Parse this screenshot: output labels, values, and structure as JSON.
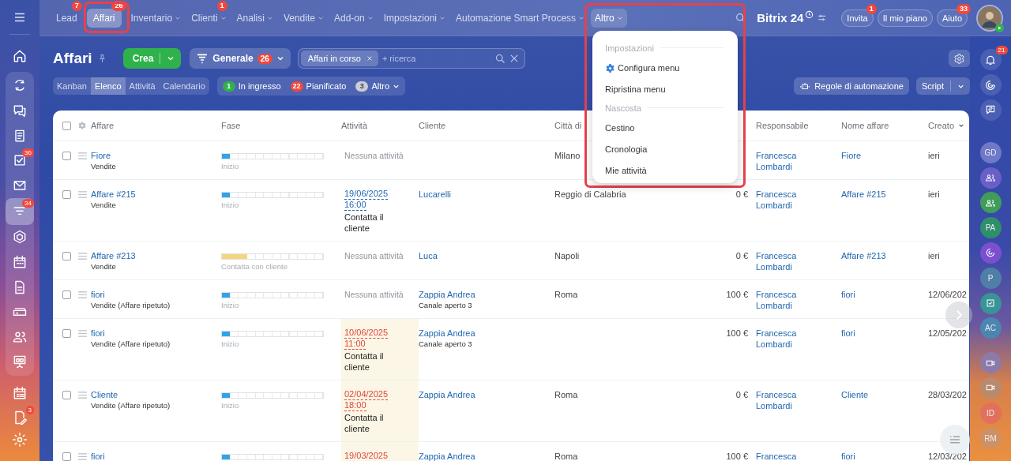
{
  "left_rail": {
    "top": [
      {
        "selected": false
      }
    ],
    "group": [
      {
        "selected": false
      },
      {
        "selected": false
      },
      {
        "selected": false
      },
      {
        "selected": false,
        "badge": "36"
      },
      {
        "selected": false
      },
      {
        "selected": true,
        "badge": "34"
      },
      {
        "selected": false
      },
      {
        "selected": false
      },
      {
        "selected": false
      },
      {
        "selected": false
      },
      {
        "selected": false
      },
      {
        "selected": false
      }
    ],
    "bottom": [
      {
        "selected": false
      },
      {
        "selected": false,
        "badge": "3"
      }
    ]
  },
  "top_nav": {
    "tabs": [
      {
        "label": "Lead",
        "badge": "7",
        "selected": false,
        "dropdown": false,
        "expanded": false,
        "highlighted": false
      },
      {
        "label": "Affari",
        "badge": "26",
        "selected": true,
        "dropdown": false,
        "expanded": false,
        "highlighted": true
      },
      {
        "label": "Inventario",
        "selected": false,
        "dropdown": true,
        "expanded": false,
        "highlighted": false
      },
      {
        "label": "Clienti",
        "badge": "1",
        "selected": false,
        "dropdown": true,
        "expanded": false,
        "highlighted": false
      },
      {
        "label": "Analisi",
        "selected": false,
        "dropdown": true,
        "expanded": false,
        "highlighted": false
      },
      {
        "label": "Vendite",
        "selected": false,
        "dropdown": true,
        "expanded": false,
        "highlighted": false
      },
      {
        "label": "Add-on",
        "selected": false,
        "dropdown": true,
        "expanded": false,
        "highlighted": false
      },
      {
        "label": "Impostazioni",
        "selected": false,
        "dropdown": true,
        "expanded": false,
        "highlighted": false
      },
      {
        "label": "Automazione Smart Process",
        "selected": false,
        "dropdown": true,
        "expanded": false,
        "highlighted": false
      },
      {
        "label": "Altro",
        "selected": false,
        "dropdown": true,
        "expanded": true,
        "highlighted": true
      }
    ],
    "logo": "Bitrix 24",
    "buttons": [
      {
        "label": "Invita",
        "badge": "1"
      },
      {
        "label": "Il mio piano"
      },
      {
        "label": "Aiuto",
        "badge": "33"
      }
    ]
  },
  "altro_menu": {
    "sections": [
      {
        "title": "Impostazioni",
        "items": [
          {
            "label": "Configura menu",
            "kind": "settings"
          },
          {
            "label": "Ripristina menu",
            "kind": "plain"
          }
        ]
      },
      {
        "title": "Nascosta",
        "items": [
          {
            "label": "Cestino",
            "kind": "plain"
          },
          {
            "label": "Cronologia",
            "kind": "plain"
          },
          {
            "label": "Mie attività",
            "kind": "plain"
          }
        ]
      }
    ]
  },
  "page": {
    "title": "Affari",
    "create_button": "Crea",
    "filter": {
      "label": "Generale",
      "badge": "26"
    },
    "search": {
      "chip": "Affari in corso",
      "placeholder": "+ ricerca"
    }
  },
  "views": [
    {
      "label": "Kanban",
      "selected": false
    },
    {
      "label": "Elenco",
      "selected": true
    },
    {
      "label": "Attività",
      "selected": false
    },
    {
      "label": "Calendario",
      "selected": false
    }
  ],
  "counters": [
    {
      "count": "1",
      "label": "In ingresso",
      "color": "#2fb24c",
      "kind": "accent",
      "dropdown": false
    },
    {
      "count": "22",
      "label": "Pianificato",
      "color": "#f0483e",
      "kind": "accent",
      "dropdown": false
    },
    {
      "count": "3",
      "label": "Altro",
      "color": "#c9ced6",
      "kind": "muted",
      "dropdown": true
    }
  ],
  "actions": {
    "automation": "Regole di automazione",
    "script": "Script"
  },
  "table": {
    "select_all_checked": false,
    "columns": [
      {
        "label": "Affare",
        "kind": "text",
        "sorted": false
      },
      {
        "label": "Fase",
        "kind": "text",
        "sorted": false
      },
      {
        "label": "Attività",
        "kind": "text",
        "sorted": false
      },
      {
        "label": "Cliente",
        "kind": "text",
        "sorted": false
      },
      {
        "label": "Città di",
        "kind": "text",
        "sorted": false
      },
      {
        "kind": "amount"
      },
      {
        "label": "Responsabile",
        "kind": "text",
        "sorted": false
      },
      {
        "label": "Nome affare",
        "kind": "text",
        "sorted": false
      },
      {
        "label": "Creato",
        "kind": "text",
        "sorted": true
      }
    ],
    "rows": [
      {
        "checked": false,
        "title": "Fiore",
        "pipeline": "Vendite",
        "phase": {
          "label": "Inizio",
          "level": 0.08,
          "color": "#2fa5e8"
        },
        "activity": {
          "kind": "none",
          "text": "Nessuna attività",
          "overdue": false
        },
        "city": "Milano",
        "owner": "Francesca Lombardi",
        "deal_name": "Fiore",
        "created": "ieri"
      },
      {
        "checked": false,
        "title": "Affare #215",
        "pipeline": "Vendite",
        "phase": {
          "label": "Inizio",
          "level": 0.08,
          "color": "#2fa5e8"
        },
        "activity": {
          "kind": "task",
          "date": "19/06/2025",
          "time": "16:00",
          "text": "Contatta il cliente",
          "overdue": false
        },
        "client": "Lucarelli",
        "city": "Reggio di Calabria",
        "amount": "0 €",
        "owner": "Francesca Lombardi",
        "deal_name": "Affare #215",
        "created": "ieri"
      },
      {
        "checked": false,
        "title": "Affare #213",
        "pipeline": "Vendite",
        "phase": {
          "label": "Contatta con cliente",
          "level": 0.25,
          "color": "#f7d57e"
        },
        "activity": {
          "kind": "none",
          "text": "Nessuna attività",
          "overdue": false
        },
        "client": "Luca",
        "city": "Napoli",
        "amount": "0 €",
        "owner": "Francesca Lombardi",
        "deal_name": "Affare #213",
        "created": "ieri"
      },
      {
        "checked": false,
        "title": "fiori",
        "pipeline": "Vendite (Affare ripetuto)",
        "phase": {
          "label": "Inizio",
          "level": 0.08,
          "color": "#2fa5e8"
        },
        "activity": {
          "kind": "none",
          "text": "Nessuna attività",
          "overdue": false
        },
        "client": "Zappia Andrea",
        "client_note": "Canale aperto 3",
        "city": "Roma",
        "amount": "100 €",
        "owner": "Francesca Lombardi",
        "deal_name": "fiori",
        "created": "12/06/202"
      },
      {
        "checked": false,
        "title": "fiori",
        "pipeline": "Vendite (Affare ripetuto)",
        "phase": {
          "label": "Inizio",
          "level": 0.08,
          "color": "#2fa5e8"
        },
        "activity": {
          "kind": "task",
          "date": "10/06/2025",
          "time": "11:00",
          "text": "Contatta il cliente",
          "overdue": true
        },
        "client": "Zappia Andrea",
        "client_note": "Canale aperto 3",
        "amount": "100 €",
        "owner": "Francesca Lombardi",
        "deal_name": "fiori",
        "created": "12/05/202"
      },
      {
        "checked": false,
        "title": "Cliente",
        "pipeline": "Vendite (Affare ripetuto)",
        "phase": {
          "label": "Inizio",
          "level": 0.08,
          "color": "#2fa5e8"
        },
        "activity": {
          "kind": "task",
          "date": "02/04/2025",
          "time": "18:00",
          "text": "Contatta il cliente",
          "overdue": true
        },
        "client": "Zappia Andrea",
        "city": "Roma",
        "amount": "0 €",
        "owner": "Francesca Lombardi",
        "deal_name": "Cliente",
        "created": "28/03/202"
      },
      {
        "checked": false,
        "title": "fiori",
        "phase": {
          "level": 0.08,
          "color": "#2fa5e8"
        },
        "activity": {
          "kind": "task",
          "date": "19/03/2025",
          "overdue": true
        },
        "client": "Zappia Andrea",
        "city": "Roma",
        "amount": "100 €",
        "owner": "Francesca",
        "deal_name": "fiori",
        "created": "12/03/202"
      }
    ]
  },
  "right_rail": [
    {
      "kind": "icon",
      "badge": "21"
    },
    {
      "kind": "icon"
    },
    {
      "kind": "icon"
    },
    {
      "kind": "initials",
      "initials": "GD",
      "color": "#7078c8"
    },
    {
      "kind": "symbol",
      "color": "#6a5fc8"
    },
    {
      "kind": "symbol",
      "color": "#3f9c5a"
    },
    {
      "kind": "initials",
      "initials": "PA",
      "color": "#2f8f6a"
    },
    {
      "kind": "symbol",
      "color": "#7a4fd0"
    },
    {
      "kind": "initials",
      "initials": "P",
      "color": "#4f7fa8"
    },
    {
      "kind": "symbol",
      "color": "#3a9396"
    },
    {
      "kind": "initials",
      "initials": "AC",
      "color": "#4b86b0"
    },
    {
      "kind": "symbol",
      "color": "#8c7aa8"
    },
    {
      "kind": "symbol",
      "color": "#b88a6e"
    },
    {
      "kind": "initials",
      "initials": "ID",
      "color": "#e2705a"
    },
    {
      "kind": "initials",
      "initials": "RM",
      "color": "#cf9064"
    }
  ]
}
